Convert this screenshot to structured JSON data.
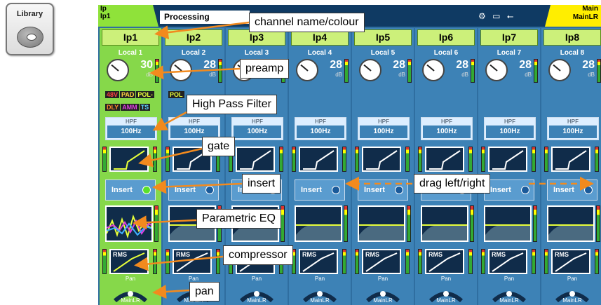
{
  "library_button": {
    "label": "Library"
  },
  "topbar": {
    "channel_line1": "Ip",
    "channel_line2": "Ip1",
    "processing_label": "Processing",
    "status_icons": "⚙ ▭ ⭠",
    "mix_line1": "Main",
    "mix_line2": "MainLR"
  },
  "strips": [
    {
      "name": "Ip1",
      "source": "Local 1",
      "gain": "30",
      "gain_unit": "dB",
      "hpf_title": "HPF",
      "hpf_value": "100Hz",
      "insert_label": "Insert",
      "rms": "RMS",
      "pan_label": "Pan",
      "pan_dest": "MainLR",
      "badges": [
        {
          "text": "48V",
          "color": "#ff4040"
        },
        {
          "text": "PAD",
          "color": "#ffd23f"
        },
        {
          "text": "POL-",
          "color": "#e8ff3a"
        },
        {
          "text": "DLY",
          "color": "#ff8a2a"
        },
        {
          "text": "AMM",
          "color": "#e040e0"
        },
        {
          "text": "TS",
          "color": "#5fd0ff"
        }
      ]
    },
    {
      "name": "Ip2",
      "source": "Local 2",
      "gain": "28",
      "gain_unit": "dB",
      "hpf_title": "HPF",
      "hpf_value": "100Hz",
      "insert_label": "Insert",
      "rms": "RMS",
      "pan_label": "Pan",
      "pan_dest": "MainLR",
      "badges": [
        {
          "text": "POL",
          "color": "#e8ff3a"
        }
      ]
    },
    {
      "name": "Ip3",
      "source": "Local 3",
      "gain": "28",
      "gain_unit": "dB",
      "hpf_title": "HPF",
      "hpf_value": "100Hz",
      "insert_label": "Insert",
      "rms": "RMS",
      "pan_label": "Pan",
      "pan_dest": "MainLR",
      "badges": []
    },
    {
      "name": "Ip4",
      "source": "Local 4",
      "gain": "28",
      "gain_unit": "dB",
      "hpf_title": "HPF",
      "hpf_value": "100Hz",
      "insert_label": "Insert",
      "rms": "RMS",
      "pan_label": "Pan",
      "pan_dest": "MainLR",
      "badges": []
    },
    {
      "name": "Ip5",
      "source": "Local 5",
      "gain": "28",
      "gain_unit": "dB",
      "hpf_title": "HPF",
      "hpf_value": "100Hz",
      "insert_label": "Insert",
      "rms": "RMS",
      "pan_label": "Pan",
      "pan_dest": "MainLR",
      "badges": []
    },
    {
      "name": "Ip6",
      "source": "Local 6",
      "gain": "28",
      "gain_unit": "dB",
      "hpf_title": "HPF",
      "hpf_value": "100Hz",
      "insert_label": "Insert",
      "rms": "RMS",
      "pan_label": "Pan",
      "pan_dest": "MainLR",
      "badges": []
    },
    {
      "name": "Ip7",
      "source": "Local 7",
      "gain": "28",
      "gain_unit": "dB",
      "hpf_title": "HPF",
      "hpf_value": "100Hz",
      "insert_label": "Insert",
      "rms": "RMS",
      "pan_label": "Pan",
      "pan_dest": "MainLR",
      "badges": []
    },
    {
      "name": "Ip8",
      "source": "Local 8",
      "gain": "28",
      "gain_unit": "dB",
      "hpf_title": "HPF",
      "hpf_value": "100Hz",
      "insert_label": "Insert",
      "rms": "RMS",
      "pan_label": "Pan",
      "pan_dest": "MainLR",
      "badges": []
    }
  ],
  "callouts": {
    "channel": "channel name/colour",
    "preamp": "preamp",
    "hpf": "High Pass Filter",
    "gate": "gate",
    "insert": "insert",
    "drag": "drag left/right",
    "peq": "Parametric EQ",
    "compressor": "compressor",
    "pan": "pan"
  },
  "colors": {
    "selected_strip": "#86d84a",
    "strip": "#3d82b6",
    "callout_arrow": "#f28a1e",
    "mix_tab": "#ffee00"
  }
}
